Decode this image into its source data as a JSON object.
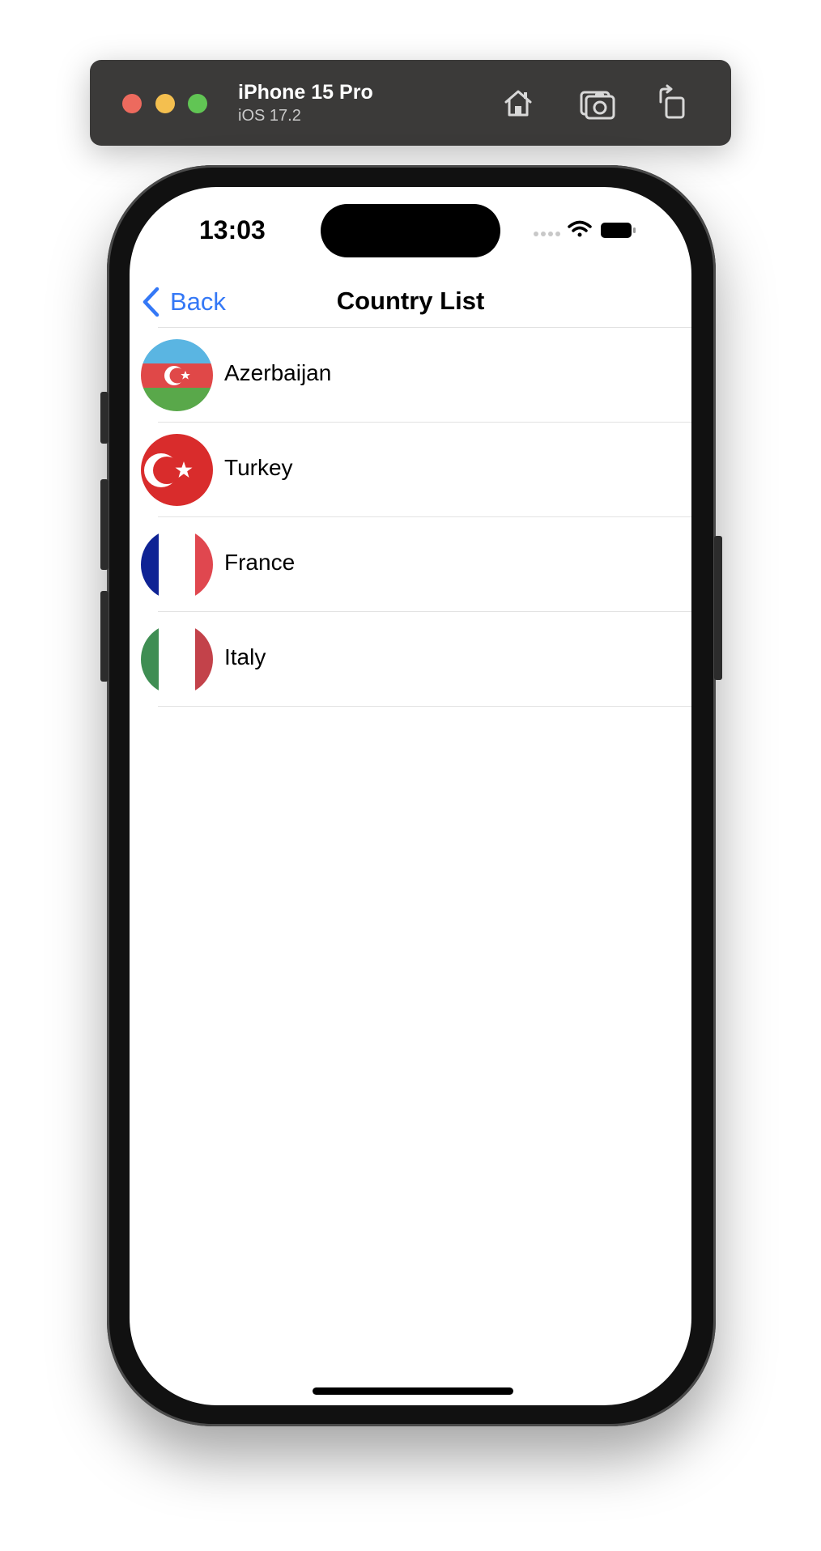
{
  "simulator": {
    "device_name": "iPhone 15 Pro",
    "os_version": "iOS 17.2",
    "buttons": [
      {
        "id": "home",
        "icon": "home-icon"
      },
      {
        "id": "screenshot",
        "icon": "camera-icon"
      },
      {
        "id": "rotate",
        "icon": "rotate-icon"
      }
    ]
  },
  "status_bar": {
    "time": "13:03",
    "icons": [
      "signal-icon",
      "wifi-icon",
      "battery-icon"
    ]
  },
  "nav": {
    "back_label": "Back",
    "title": "Country List"
  },
  "countries": [
    {
      "name": "Azerbaijan",
      "flag": "azerbaijan-flag-icon"
    },
    {
      "name": "Turkey",
      "flag": "turkey-flag-icon"
    },
    {
      "name": "France",
      "flag": "france-flag-icon"
    },
    {
      "name": "Italy",
      "flag": "italy-flag-icon"
    }
  ],
  "colors": {
    "accent": "#3478f6",
    "separator": "#e2e2e2",
    "sim_bar": "#3b3a39"
  }
}
